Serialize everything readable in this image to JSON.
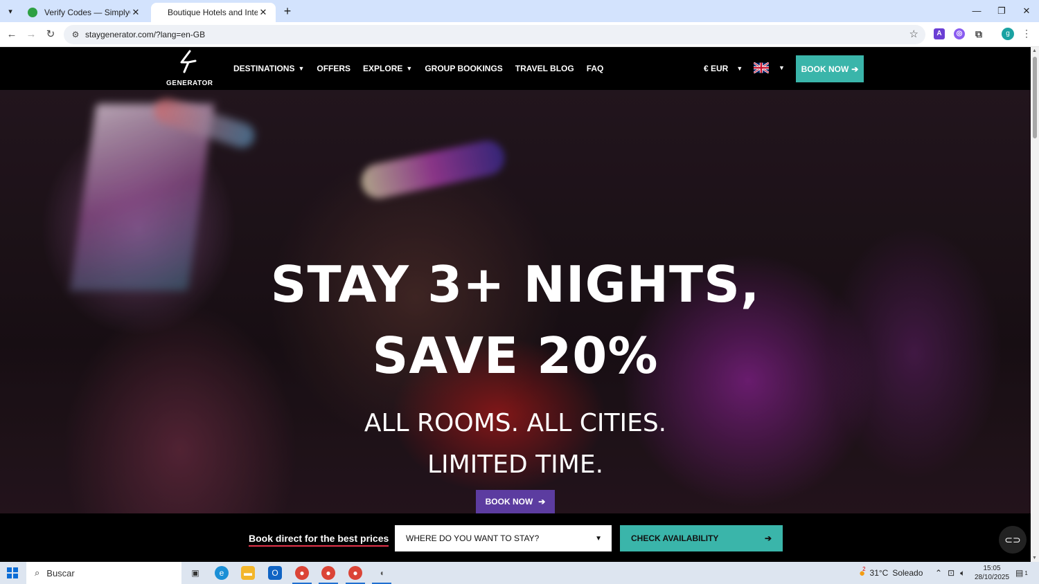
{
  "browser": {
    "tabs": [
      {
        "title": "Verify Codes — SimplyCodes",
        "active": false
      },
      {
        "title": "Boutique Hotels and Internatio",
        "active": true
      }
    ],
    "url": "staygenerator.com/?lang=en-GB",
    "profile_initial": "g"
  },
  "site": {
    "logo_text": "GENERATOR",
    "menu": [
      {
        "label": "DESTINATIONS",
        "dropdown": true
      },
      {
        "label": "OFFERS",
        "dropdown": false
      },
      {
        "label": "EXPLORE",
        "dropdown": true
      },
      {
        "label": "GROUP BOOKINGS",
        "dropdown": false
      },
      {
        "label": "TRAVEL BLOG",
        "dropdown": false
      },
      {
        "label": "FAQ",
        "dropdown": false
      }
    ],
    "currency": "€ EUR",
    "book_now_nav": "BOOK NOW",
    "accent_color": "#3ab5aa"
  },
  "hero": {
    "headline_line1": "STAY 3+ NIGHTS,",
    "headline_line2": "SAVE 20%",
    "subheadline": "ALL ROOMS. ALL CITIES. LIMITED TIME.",
    "cta": "BOOK NOW",
    "cta_color": "#5c3ca0"
  },
  "booking": {
    "tagline": "Book direct for the best prices",
    "destination_placeholder": "WHERE DO YOU WANT TO STAY?",
    "check_button": "CHECK AVAILABILITY"
  },
  "taskbar": {
    "search_placeholder": "Buscar",
    "weather_temp": "31°C",
    "weather_desc": "Soleado",
    "time": "15:05",
    "date": "28/10/2025",
    "weather_badge": "2",
    "notif_count": "1"
  }
}
